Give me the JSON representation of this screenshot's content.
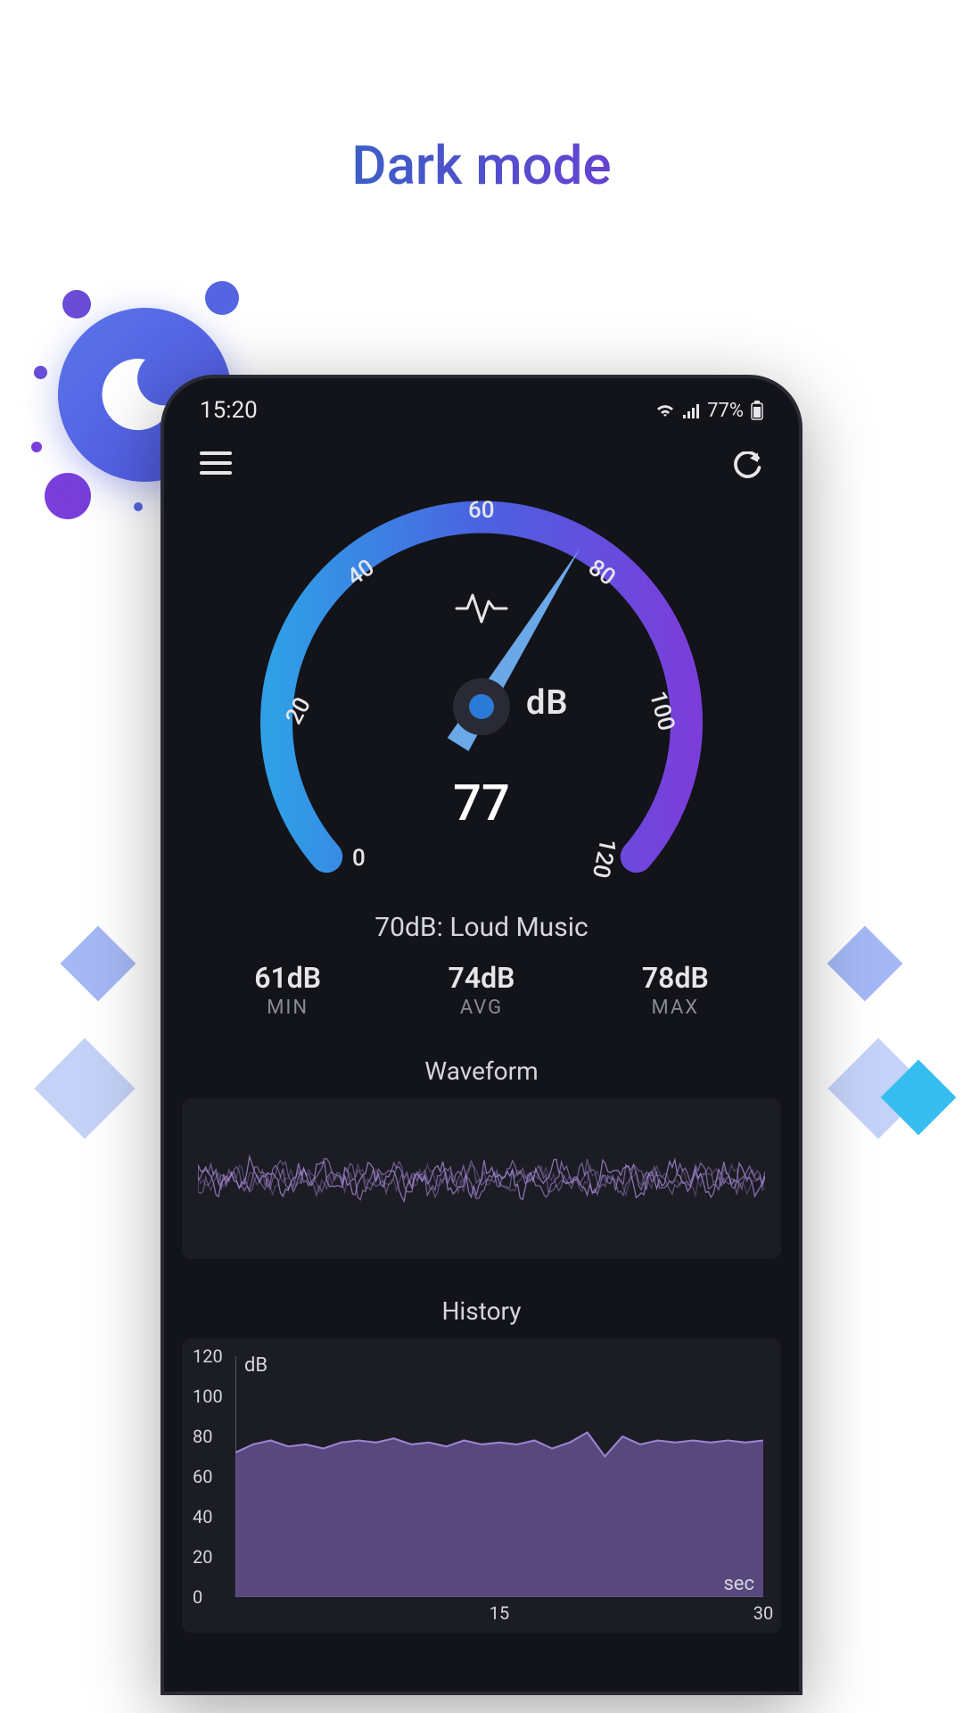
{
  "page_title": "Dark mode",
  "status_bar": {
    "time": "15:20",
    "battery": "77%"
  },
  "gauge": {
    "unit": "dB",
    "current_value": "77",
    "ticks": [
      "0",
      "20",
      "40",
      "60",
      "80",
      "100",
      "120"
    ],
    "min": 0,
    "max": 120
  },
  "description": "70dB: Loud Music",
  "stats": {
    "min": {
      "value": "61dB",
      "label": "MIN"
    },
    "avg": {
      "value": "74dB",
      "label": "AVG"
    },
    "max": {
      "value": "78dB",
      "label": "MAX"
    }
  },
  "sections": {
    "waveform": "Waveform",
    "history": "History"
  },
  "chart_data": {
    "type": "area",
    "title": "History",
    "xlabel": "sec",
    "ylabel": "dB",
    "ylim": [
      0,
      120
    ],
    "y_ticks": [
      0,
      20,
      40,
      60,
      80,
      100,
      120
    ],
    "x_ticks": [
      15,
      30
    ],
    "x": [
      0,
      1,
      2,
      3,
      4,
      5,
      6,
      7,
      8,
      9,
      10,
      11,
      12,
      13,
      14,
      15,
      16,
      17,
      18,
      19,
      20,
      21,
      22,
      23,
      24,
      25,
      26,
      27,
      28,
      29,
      30
    ],
    "values": [
      72,
      76,
      78,
      75,
      76,
      74,
      77,
      78,
      77,
      79,
      76,
      77,
      75,
      78,
      76,
      77,
      76,
      78,
      74,
      77,
      82,
      70,
      80,
      76,
      78,
      77,
      78,
      77,
      78,
      77,
      78
    ]
  },
  "colors": {
    "accent_blue": "#37a5e8",
    "accent_purple": "#7a3edb",
    "needle": "#6aa8e8",
    "waveform": "#a88ad6",
    "area_fill": "#6d579c"
  }
}
